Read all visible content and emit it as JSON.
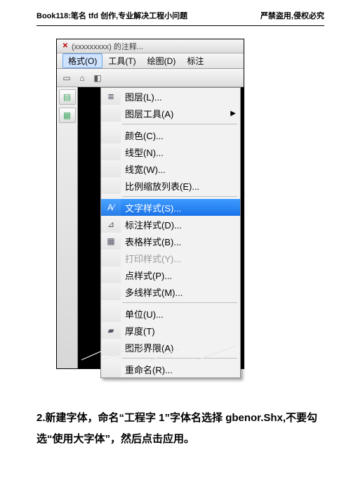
{
  "header": {
    "left": "Book118:笔名 tfd 创作,专业解决工程小问题",
    "right": "严禁盗用,侵权必究"
  },
  "titlebar": {
    "text": "(xxxxxxxxx) 的注释..."
  },
  "menubar": {
    "format": "格式(O)",
    "tools": "工具(T)",
    "draw": "绘图(D)",
    "dimension": "标注"
  },
  "dropdown": {
    "layer": "图层(L)...",
    "layertools": "图层工具(A)",
    "color": "颜色(C)...",
    "linetype": "线型(N)...",
    "lineweight": "线宽(W)...",
    "scalelist": "比例缩放列表(E)...",
    "textstyle": "文字样式(S)...",
    "dimstyle": "标注样式(D)...",
    "tablestyle": "表格样式(B)...",
    "plotstyle": "打印样式(Y)...",
    "pointstyle": "点样式(P)...",
    "mlinestyle": "多线样式(M)...",
    "units": "单位(U)...",
    "thickness": "厚度(T)",
    "limits": "图形界限(A)",
    "rename": "重命名(R)..."
  },
  "instruction": {
    "text": "2.新建字体，命名“工程字 1”字体名选择 gbenor.Shx,不要勾选“使用大字体”，然后点击应用。"
  }
}
